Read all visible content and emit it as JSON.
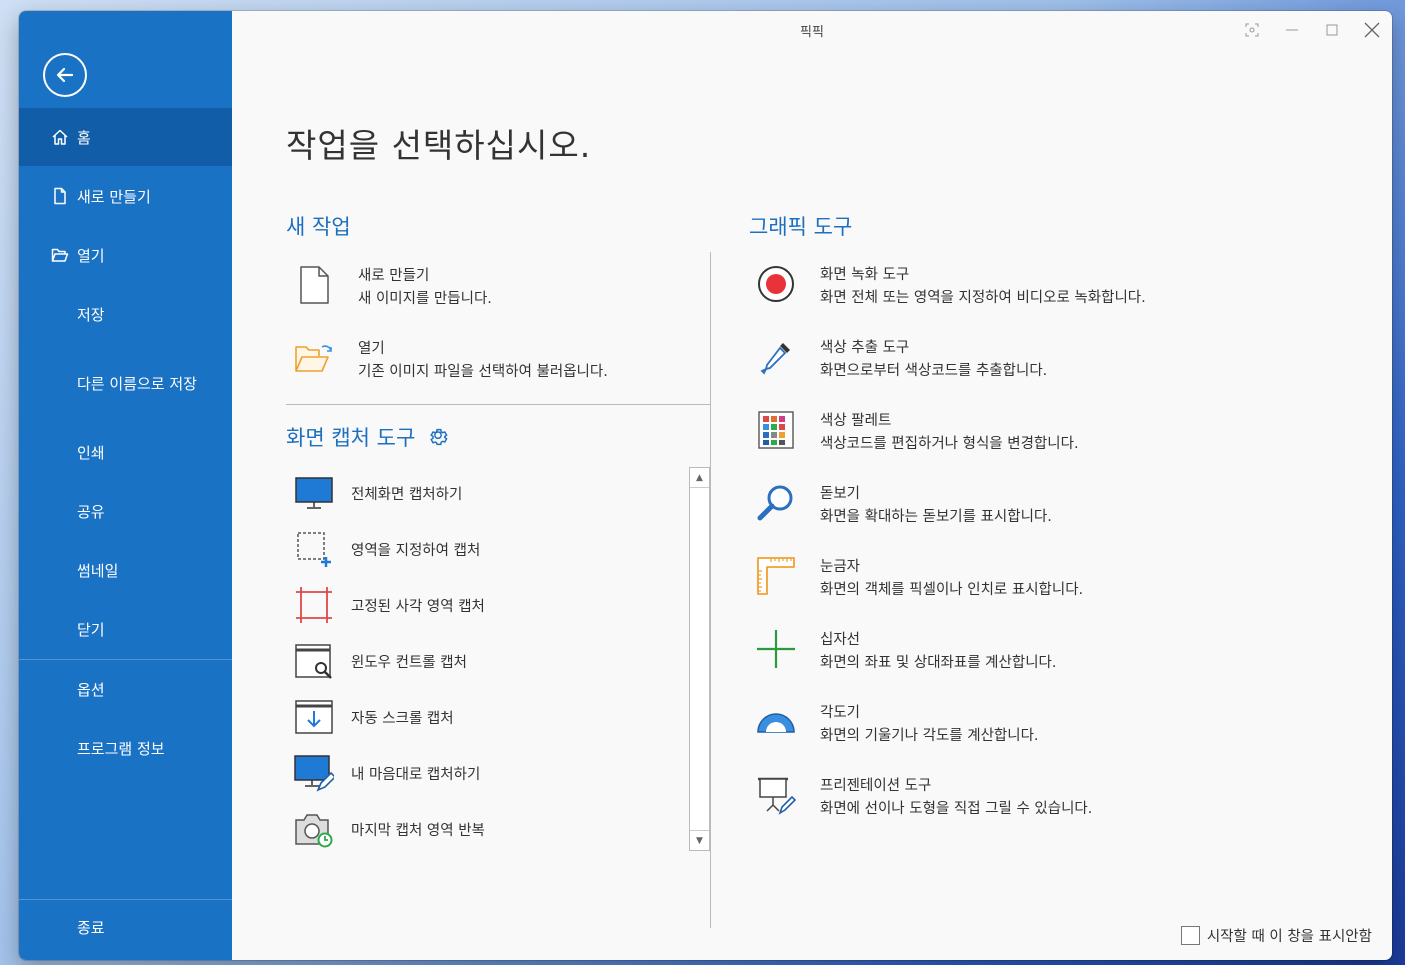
{
  "window": {
    "title": "픽픽"
  },
  "sidebar": {
    "items": [
      {
        "label": "홈",
        "icon": "home-icon",
        "active": true
      },
      {
        "label": "새로 만들기",
        "icon": "new-file-icon"
      },
      {
        "label": "열기",
        "icon": "folder-open-icon"
      },
      {
        "label": "저장"
      },
      {
        "label": "다른 이름으로 저장"
      },
      {
        "label": "인쇄"
      },
      {
        "label": "공유"
      },
      {
        "label": "썸네일"
      },
      {
        "label": "닫기"
      },
      {
        "label": "옵션"
      },
      {
        "label": "프로그램 정보"
      }
    ],
    "exit_label": "종료"
  },
  "main": {
    "title": "작업을 선택하십시오.",
    "new_work": {
      "heading": "새 작업",
      "items": [
        {
          "name": "새로 만들기",
          "desc": "새 이미지를 만듭니다."
        },
        {
          "name": "열기",
          "desc": "기존 이미지 파일을 선택하여 불러옵니다."
        }
      ]
    },
    "capture": {
      "heading": "화면 캡처 도구",
      "items": [
        {
          "name": "전체화면 캡처하기"
        },
        {
          "name": "영역을 지정하여 캡처"
        },
        {
          "name": "고정된 사각 영역 캡처"
        },
        {
          "name": "윈도우 컨트롤 캡처"
        },
        {
          "name": "자동 스크롤 캡처"
        },
        {
          "name": "내 마음대로 캡처하기"
        },
        {
          "name": "마지막 캡처 영역 반복"
        }
      ]
    },
    "graphic": {
      "heading": "그래픽 도구",
      "items": [
        {
          "name": "화면 녹화 도구",
          "desc": "화면 전체 또는 영역을 지정하여 비디오로 녹화합니다."
        },
        {
          "name": "색상 추출 도구",
          "desc": "화면으로부터 색상코드를 추출합니다."
        },
        {
          "name": "색상 팔레트",
          "desc": "색상코드를 편집하거나 형식을 변경합니다."
        },
        {
          "name": "돋보기",
          "desc": "화면을 확대하는 돋보기를 표시합니다."
        },
        {
          "name": "눈금자",
          "desc": "화면의 객체를 픽셀이나 인치로 표시합니다."
        },
        {
          "name": "십자선",
          "desc": "화면의 좌표 및 상대좌표를 계산합니다."
        },
        {
          "name": "각도기",
          "desc": "화면의 기울기나 각도를 계산합니다."
        },
        {
          "name": "프리젠테이션 도구",
          "desc": "화면에 선이나 도형을 직접 그릴 수 있습니다."
        }
      ]
    },
    "startup_checkbox": {
      "label": "시작할 때 이 창을 표시안함",
      "checked": false
    }
  },
  "colors": {
    "sidebar": "#1a72c4",
    "sidebar_active": "#115da8",
    "accent": "#1f6fbf"
  }
}
